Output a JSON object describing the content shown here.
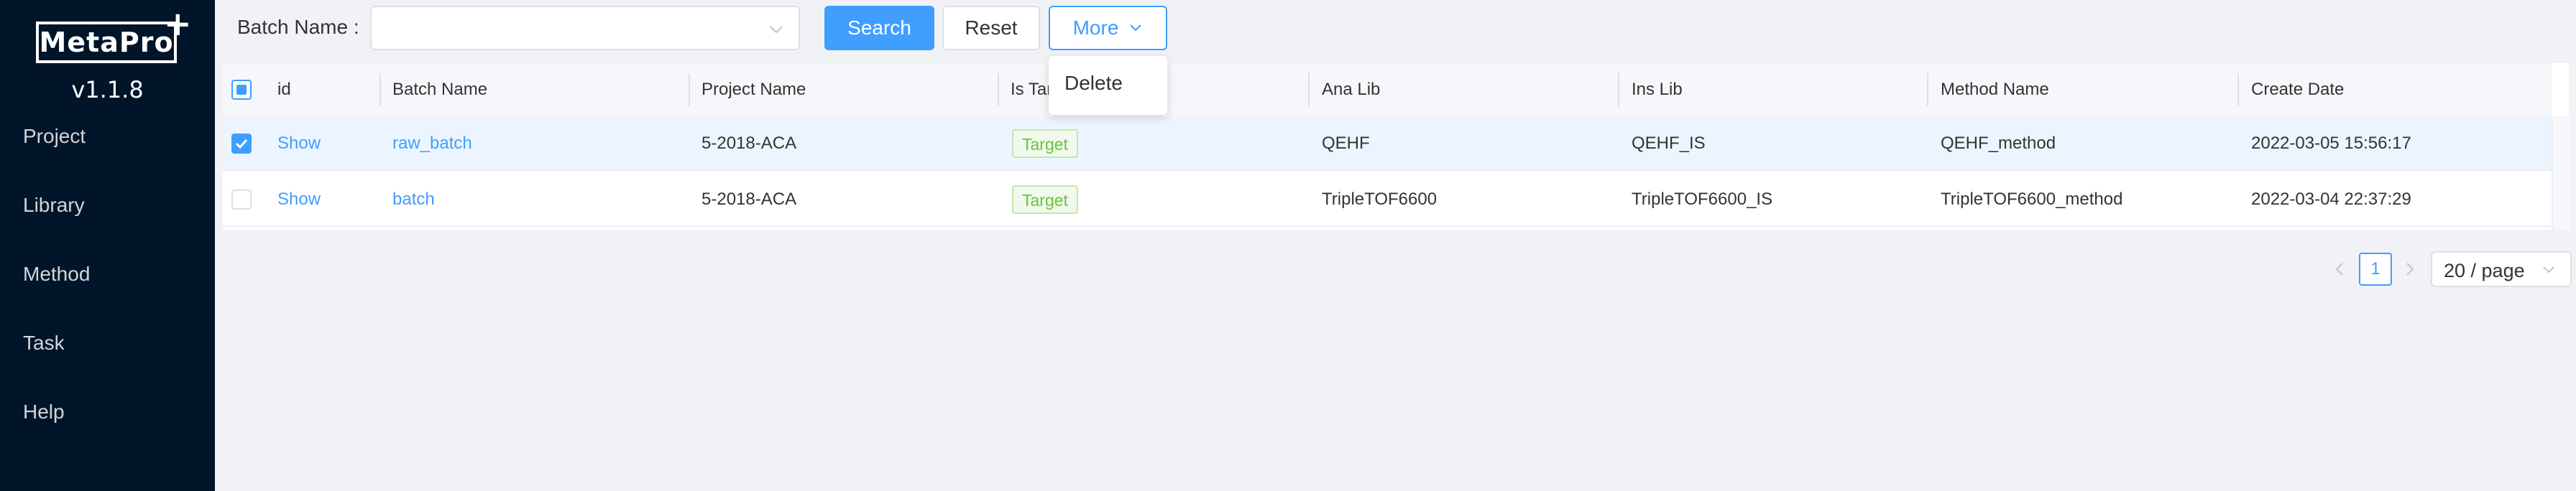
{
  "app": {
    "logo_text": "MetaPro",
    "logo_plus": "+",
    "version": "v1.1.8"
  },
  "sidebar": {
    "items": [
      {
        "label": "Project"
      },
      {
        "label": "Library"
      },
      {
        "label": "Method"
      },
      {
        "label": "Task"
      },
      {
        "label": "Help"
      }
    ]
  },
  "search": {
    "label": "Batch Name :",
    "value": "",
    "placeholder": "",
    "search_button": "Search",
    "reset_button": "Reset",
    "more_button": "More"
  },
  "more_menu": {
    "items": [
      {
        "label": "Delete"
      }
    ]
  },
  "table": {
    "columns": [
      "id",
      "Batch Name",
      "Project Name",
      "Is Target",
      "Ana Lib",
      "Ins Lib",
      "Method Name",
      "Create Date"
    ],
    "rows": [
      {
        "selected": true,
        "id": "Show",
        "batch_name": "raw_batch",
        "project_name": "5-2018-ACA",
        "is_target": "Target",
        "ana_lib": "QEHF",
        "ins_lib": "QEHF_IS",
        "method_name": "QEHF_method",
        "create_date": "2022-03-05 15:56:17"
      },
      {
        "selected": false,
        "id": "Show",
        "batch_name": "batch",
        "project_name": "5-2018-ACA",
        "is_target": "Target",
        "ana_lib": "TripleTOF6600",
        "ins_lib": "TripleTOF6600_IS",
        "method_name": "TripleTOF6600_method",
        "create_date": "2022-03-04 22:37:29"
      }
    ]
  },
  "pagination": {
    "current_page": "1",
    "page_size": "20 / page"
  },
  "colors": {
    "sidebar_bg": "#001529",
    "primary": "#409eff",
    "tag_green": "#67c23a"
  }
}
